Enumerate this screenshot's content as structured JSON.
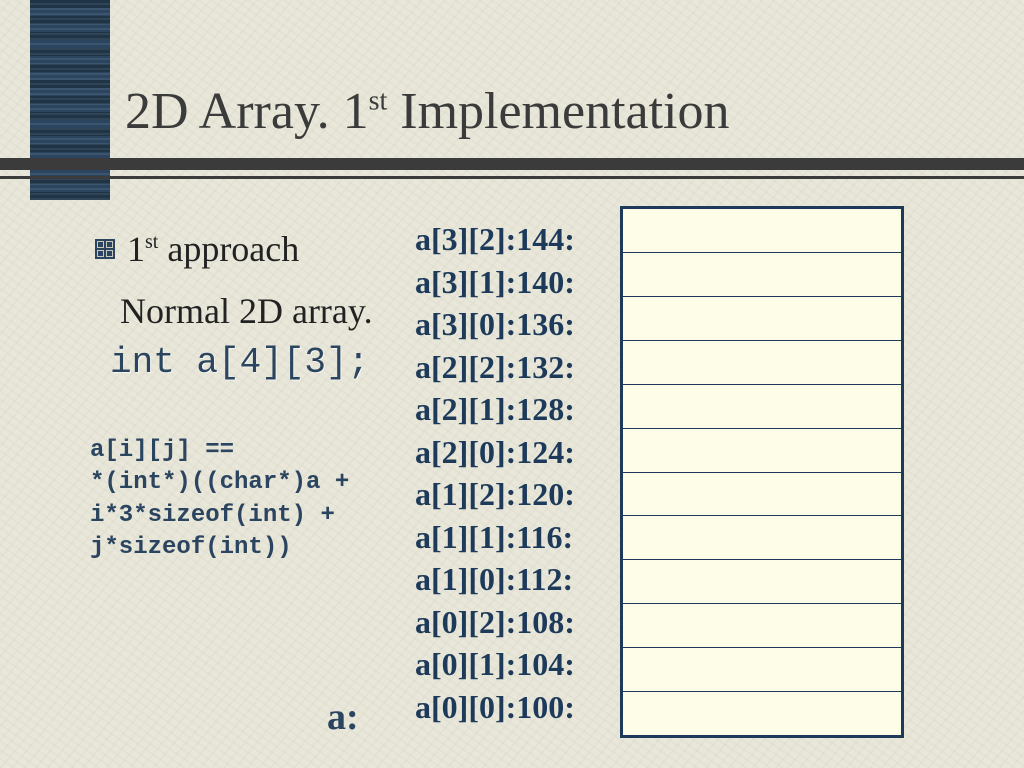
{
  "title": {
    "prefix": "2D Array. 1",
    "sup": "st",
    "suffix": " Implementation"
  },
  "bullet": {
    "prefix": "1",
    "sup": "st",
    "suffix": " approach"
  },
  "subline": "Normal 2D array.",
  "code_decl": "int a[4][3];",
  "code_expr": "a[i][j] ==\n*(int*)((char*)a +\ni*3*sizeof(int) +\nj*sizeof(int))",
  "a_label": "a:",
  "addresses": [
    "a[3][2]:144:",
    "a[3][1]:140:",
    "a[3][0]:136:",
    "a[2][2]:132:",
    "a[2][1]:128:",
    "a[2][0]:124:",
    "a[1][2]:120:",
    "a[1][1]:116:",
    "a[1][0]:112:",
    "a[0][2]:108:",
    "a[0][1]:104:",
    "a[0][0]:100:"
  ],
  "memory_cells": 12
}
